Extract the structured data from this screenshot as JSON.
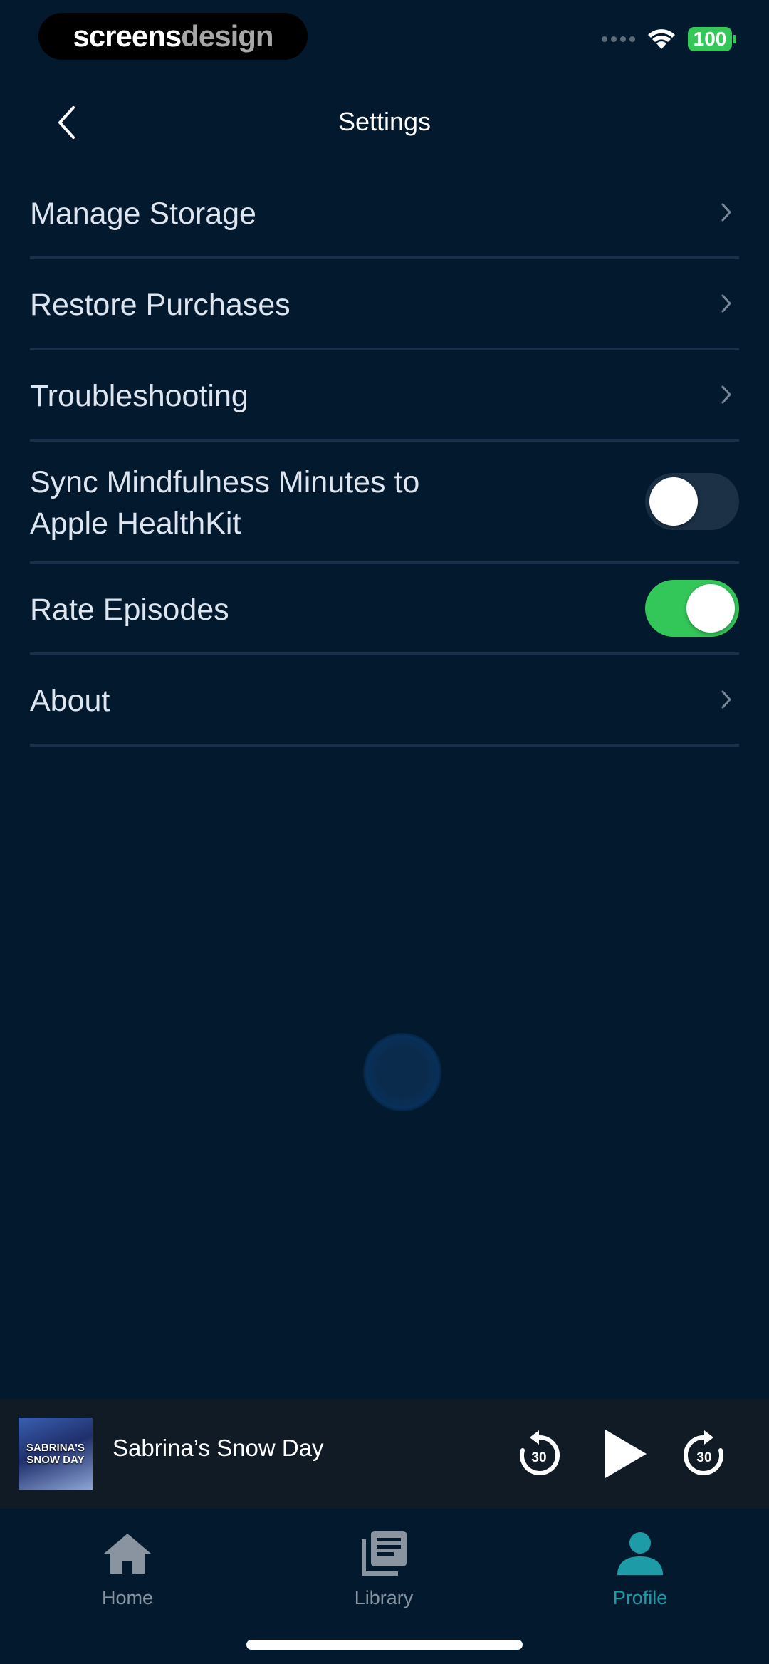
{
  "status_bar": {
    "brand_bold": "screens",
    "brand_light": "design",
    "battery": "100"
  },
  "header": {
    "title": "Settings"
  },
  "settings": {
    "items": [
      {
        "label": "Manage Storage",
        "control": "chevron-right-icon"
      },
      {
        "label": "Restore Purchases",
        "control": "chevron-right-icon"
      },
      {
        "label": "Troubleshooting",
        "control": "chevron-right-icon"
      },
      {
        "label": "Sync Mindfulness Minutes to Apple HealthKit",
        "line1": "Sync Mindfulness Minutes to",
        "line2": "Apple HealthKit",
        "control": "toggle",
        "on": false
      },
      {
        "label": "Rate Episodes",
        "control": "toggle",
        "on": true
      },
      {
        "label": "About",
        "control": "chevron-right-icon"
      }
    ]
  },
  "player": {
    "artwork_text_line1": "SABRINA'S",
    "artwork_text_line2": "SNOW DAY",
    "track_title": "Sabrina’s Snow Day",
    "rewind_seconds": "30",
    "forward_seconds": "30"
  },
  "tabs": [
    {
      "label": "Home",
      "icon": "home-icon",
      "active": false
    },
    {
      "label": "Library",
      "icon": "library-icon",
      "active": false
    },
    {
      "label": "Profile",
      "icon": "profile-icon",
      "active": true
    }
  ],
  "colors": {
    "background": "#031a2e",
    "toggle_on": "#33c759",
    "active_tab": "#1d9ba6",
    "divider": "#17324a"
  }
}
